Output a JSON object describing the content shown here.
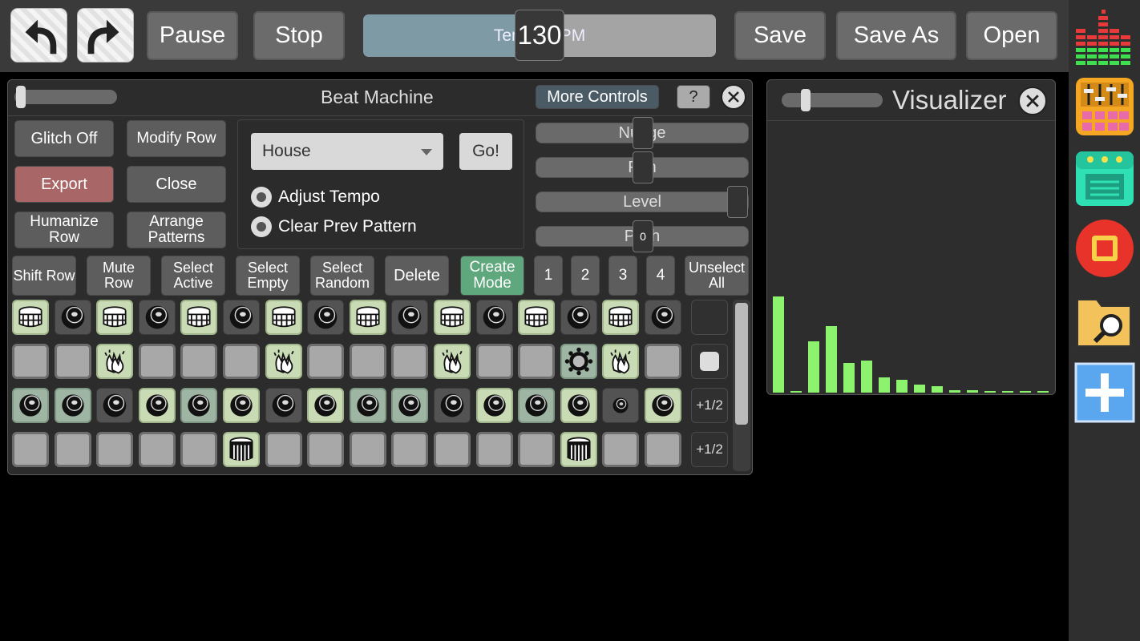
{
  "topbar": {
    "pause_label": "Pause",
    "stop_label": "Stop",
    "tempo_label": "Tempo BPM",
    "tempo_value": "130",
    "tempo_fraction": 0.44,
    "save_label": "Save",
    "save_as_label": "Save As",
    "open_label": "Open"
  },
  "beat_machine": {
    "title": "Beat Machine",
    "more_controls": "More Controls",
    "help": "?",
    "buttons": {
      "glitch": "Glitch Off",
      "modify_row": "Modify Row",
      "export": "Export",
      "close": "Close",
      "humanize_row": "Humanize Row",
      "arrange_patterns": "Arrange Patterns"
    },
    "genre": "House",
    "go": "Go!",
    "adjust_tempo": "Adjust Tempo",
    "clear_prev_pattern": "Clear Prev Pattern",
    "sliders": {
      "nudge": "Nudge",
      "pan": "Pan",
      "level": "Level",
      "pitch": "Pitch",
      "pitch_value": "0"
    },
    "select_buttons": {
      "shift_row": "Shift Row",
      "mute_row": "Mute Row",
      "select_active": "Select Active",
      "select_empty": "Select Empty",
      "select_random": "Select Random",
      "delete": "Delete",
      "create_mode": "Create Mode",
      "p1": "1",
      "p2": "2",
      "p3": "3",
      "p4": "4",
      "unselect_all": "Unselect All"
    },
    "row_controls": [
      "",
      "",
      "+1/2",
      "+1/2"
    ],
    "grid": [
      [
        "drum-on",
        "hat-dark",
        "drum-on",
        "hat-dark",
        "drum-on",
        "hat-dark",
        "drum-on",
        "hat-dark",
        "drum-on",
        "hat-dark",
        "drum-on",
        "hat-dark",
        "drum-on",
        "hat-dark",
        "drum-on",
        "hat-dark"
      ],
      [
        "off",
        "off",
        "clap-on",
        "off",
        "off",
        "off",
        "clap-on",
        "off",
        "off",
        "off",
        "clap-on",
        "off",
        "off",
        "tamb-mid",
        "clap-on",
        "off"
      ],
      [
        "hat-mid",
        "hat-mid",
        "hat-dark",
        "hat-on",
        "hat-mid",
        "hat-on",
        "hat-dark",
        "hat-on",
        "hat-mid",
        "hat-mid",
        "hat-dark",
        "hat-on",
        "hat-mid",
        "hat-on",
        "hat-small",
        "hat-on"
      ],
      [
        "off",
        "off",
        "off",
        "off",
        "off",
        "snare-on",
        "off",
        "off",
        "off",
        "off",
        "off",
        "off",
        "off",
        "snare-on",
        "off",
        "off"
      ]
    ]
  },
  "visualizer": {
    "title": "Visualizer",
    "bars": [
      0.75,
      0.01,
      0.4,
      0.52,
      0.23,
      0.25,
      0.12,
      0.1,
      0.06,
      0.05,
      0.02,
      0.02,
      0.01,
      0.01,
      0.01,
      0.01
    ],
    "bar_color": "#8df26e"
  },
  "sidebar": {
    "apps": [
      "equalizer-icon",
      "mixer-icon",
      "synth-icon",
      "record-icon",
      "folder-search-icon",
      "add-icon"
    ]
  }
}
